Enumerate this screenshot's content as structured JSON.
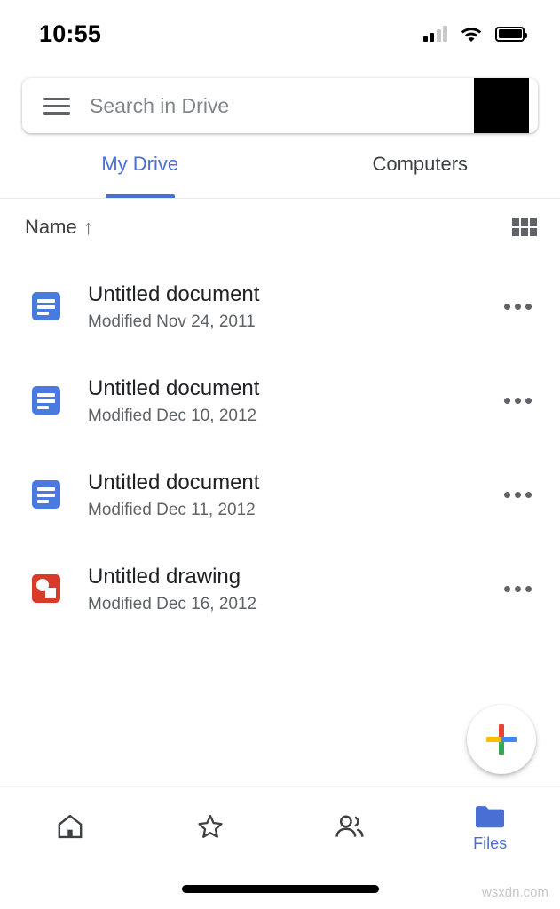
{
  "status_bar": {
    "time": "10:55",
    "signal_icon": "signal-bars-icon",
    "signal_bars_filled": 2,
    "signal_bars_total": 4,
    "wifi_icon": "wifi-icon",
    "battery_icon": "battery-full-icon"
  },
  "search": {
    "menu_icon": "hamburger-menu-icon",
    "placeholder": "Search in Drive",
    "value": "",
    "avatar_icon": "account-avatar"
  },
  "tabs": [
    {
      "label": "My Drive",
      "active": true
    },
    {
      "label": "Computers",
      "active": false
    }
  ],
  "list_header": {
    "sort_label": "Name",
    "sort_direction_icon": "arrow-up-icon",
    "sort_arrow": "↑",
    "view_toggle_icon": "grid-view-icon"
  },
  "files": [
    {
      "name": "Untitled document",
      "modified": "Modified Nov 24, 2011",
      "icon": "google-docs-icon",
      "icon_type": "doc",
      "icon_color": "#4a7ae0",
      "more_icon": "more-options-icon"
    },
    {
      "name": "Untitled document",
      "modified": "Modified Dec 10, 2012",
      "icon": "google-docs-icon",
      "icon_type": "doc",
      "icon_color": "#4a7ae0",
      "more_icon": "more-options-icon"
    },
    {
      "name": "Untitled document",
      "modified": "Modified Dec 11, 2012",
      "icon": "google-docs-icon",
      "icon_type": "doc",
      "icon_color": "#4a7ae0",
      "more_icon": "more-options-icon"
    },
    {
      "name": "Untitled drawing",
      "modified": "Modified Dec 16, 2012",
      "icon": "google-drawings-icon",
      "icon_type": "drawing",
      "icon_color": "#d93b2b",
      "more_icon": "more-options-icon"
    }
  ],
  "fab": {
    "icon": "plus-icon",
    "label": "",
    "colors": [
      "#ea4335",
      "#fbbc05",
      "#34a853",
      "#4285f4"
    ]
  },
  "bottom_nav": [
    {
      "label": "",
      "icon": "home-icon",
      "active": false
    },
    {
      "label": "",
      "icon": "star-icon",
      "active": false
    },
    {
      "label": "",
      "icon": "shared-people-icon",
      "active": false
    },
    {
      "label": "Files",
      "icon": "folder-icon",
      "active": true
    }
  ],
  "colors": {
    "accent": "#4a6fd4",
    "text_primary": "#202124",
    "text_secondary": "#5f6368",
    "docs_blue": "#4a7ae0",
    "drawings_red": "#d93b2b",
    "background": "#ffffff"
  },
  "watermark": "wsxdn.com"
}
